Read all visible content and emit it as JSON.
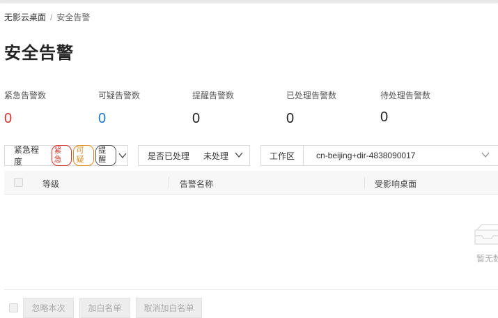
{
  "breadcrumb": {
    "root": "无影云桌面",
    "separator": "/",
    "current": "安全告警"
  },
  "page_title": "安全告警",
  "stats": [
    {
      "label": "紧急告警数",
      "value": "0",
      "color": "#d0342c"
    },
    {
      "label": "可疑告警数",
      "value": "0",
      "color": "#1d77c5"
    },
    {
      "label": "提醒告警数",
      "value": "0",
      "color": "#222222"
    },
    {
      "label": "已处理告警数",
      "value": "0",
      "color": "#222222"
    },
    {
      "label": "待处理告警数",
      "value": "0",
      "color": "#222222"
    }
  ],
  "filters": {
    "severity": {
      "label": "紧急程度",
      "tags": [
        "紧急",
        "可疑",
        "提醒"
      ]
    },
    "handled": {
      "label": "是否已处理",
      "value": "未处理"
    },
    "workspace": {
      "label": "工作区",
      "value": "cn-beijing+dir-4838090017"
    }
  },
  "table": {
    "columns": [
      "等级",
      "告警名称",
      "受影响桌面"
    ],
    "rows": [],
    "empty_text": "暂无数据"
  },
  "actions": {
    "ignore_label": "忽略本次",
    "whitelist_label": "加白名单",
    "cancel_whitelist_label": "取消加白名单"
  }
}
